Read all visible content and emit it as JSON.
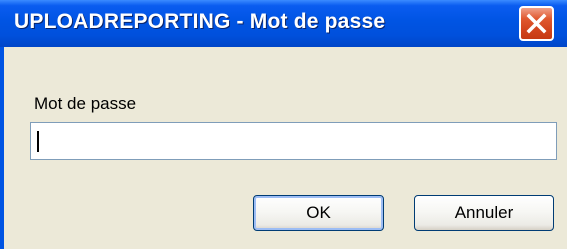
{
  "window": {
    "title": "UPLOADREPORTING - Mot de passe",
    "close_icon": "close-icon"
  },
  "dialog": {
    "prompt_label": "Mot de passe",
    "password_value": "",
    "ok_label": "OK",
    "cancel_label": "Annuler"
  },
  "colors": {
    "titlebar": "#0054e3",
    "client_background": "#ece9d8",
    "close_button": "#d2441d",
    "input_border": "#7f9db9"
  }
}
